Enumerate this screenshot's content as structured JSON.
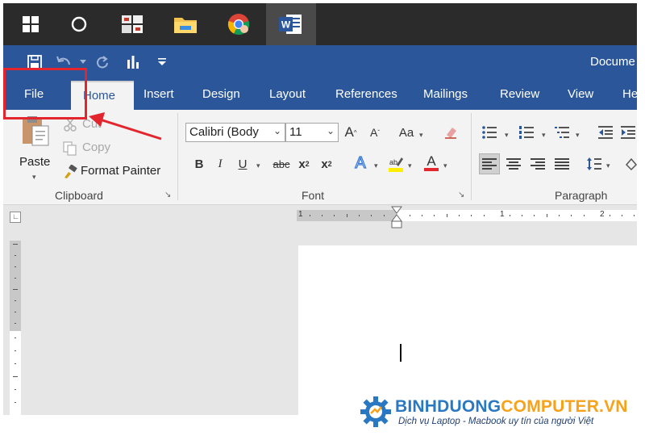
{
  "taskbar": {
    "icons": [
      "windows-start-icon",
      "cortana-icon",
      "taskbar-app-icon",
      "file-explorer-icon",
      "chrome-icon",
      "word-icon"
    ],
    "word_icon_letter": "W"
  },
  "title_bar": {
    "document_title": "Docume"
  },
  "ribbon_tabs": [
    "File",
    "Home",
    "Insert",
    "Design",
    "Layout",
    "References",
    "Mailings",
    "Review",
    "View",
    "He"
  ],
  "clipboard": {
    "group_label": "Clipboard",
    "paste": "Paste",
    "cut": "Cut",
    "copy": "Copy",
    "format_painter": "Format Painter"
  },
  "font": {
    "group_label": "Font",
    "font_name": "Calibri (Body",
    "font_size": "11",
    "grow": "A",
    "shrink": "A",
    "change_case": "Aa",
    "bold": "B",
    "italic": "I",
    "underline": "U",
    "strikethrough": "abc",
    "subscript": "x",
    "subscript_digit": "2",
    "superscript": "x",
    "superscript_digit": "2",
    "text_effects": "A",
    "font_color": "A"
  },
  "paragraph": {
    "group_label": "Paragraph"
  },
  "ruler": {
    "numbers": [
      "1",
      "1",
      "2"
    ]
  },
  "watermark": {
    "name_part1": "BINHDUONG",
    "name_part2": "COMPUTER.VN",
    "tagline": "Dịch vụ Laptop - Macbook uy tín của người Việt"
  },
  "colors": {
    "word_blue": "#2b579a",
    "taskbar": "#2b2b2b",
    "highlight_red": "#e3262e",
    "logo_blue": "#2a78c2",
    "logo_orange": "#f7a21b"
  }
}
